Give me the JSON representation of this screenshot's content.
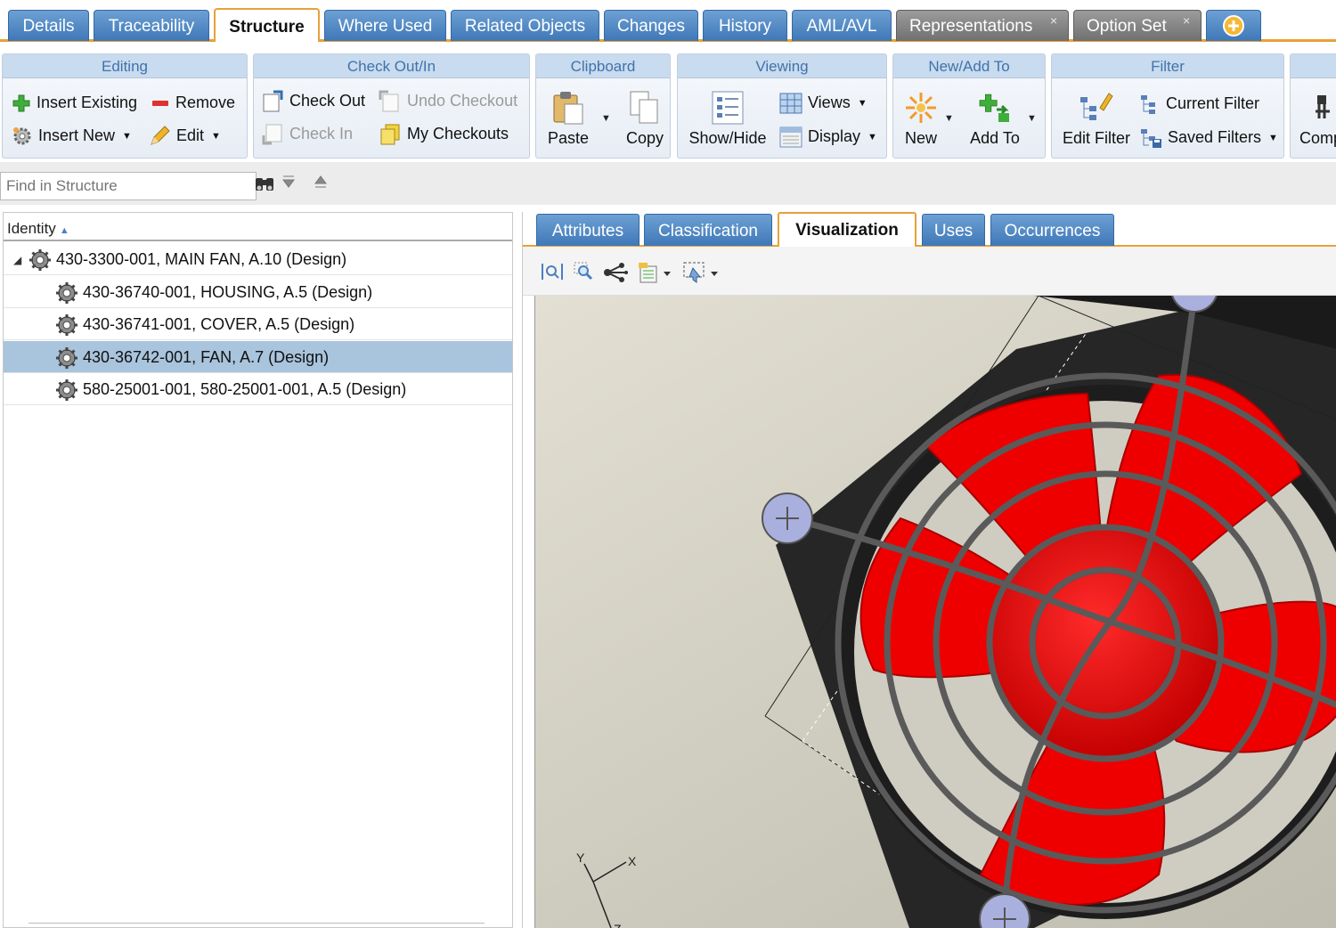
{
  "top_tabs": [
    {
      "label": "Details"
    },
    {
      "label": "Traceability"
    },
    {
      "label": "Structure"
    },
    {
      "label": "Where Used"
    },
    {
      "label": "Related Objects"
    },
    {
      "label": "Changes"
    },
    {
      "label": "History"
    },
    {
      "label": "AML/AVL"
    },
    {
      "label": "Representations",
      "close": "×"
    },
    {
      "label": "Option Set",
      "close": "×"
    }
  ],
  "active_top_tab": "Structure",
  "ribbon": {
    "editing": {
      "title": "Editing",
      "insert_existing": "Insert Existing",
      "remove": "Remove",
      "insert_new": "Insert New",
      "edit": "Edit"
    },
    "checkout": {
      "title": "Check Out/In",
      "check_out": "Check Out",
      "undo_checkout": "Undo Checkout",
      "check_in": "Check In",
      "my_checkouts": "My Checkouts"
    },
    "clipboard": {
      "title": "Clipboard",
      "paste": "Paste",
      "copy": "Copy"
    },
    "viewing": {
      "title": "Viewing",
      "show_hide": "Show/Hide",
      "views": "Views",
      "display": "Display"
    },
    "new_add": {
      "title": "New/Add To",
      "new": "New",
      "add_to": "Add To"
    },
    "filter": {
      "title": "Filter",
      "edit_filter": "Edit Filter",
      "current_filter": "Current Filter",
      "saved_filters": "Saved Filters"
    },
    "compare": {
      "label": "Comp"
    }
  },
  "find": {
    "placeholder": "Find in Structure"
  },
  "tree": {
    "column_header": "Identity",
    "rows": [
      {
        "label": "430-3300-001, MAIN FAN, A.10 (Design)",
        "level": 0,
        "expanded": true,
        "selected": false
      },
      {
        "label": "430-36740-001, HOUSING, A.5 (Design)",
        "level": 1,
        "selected": false
      },
      {
        "label": "430-36741-001, COVER, A.5 (Design)",
        "level": 1,
        "selected": false
      },
      {
        "label": "430-36742-001, FAN, A.7 (Design)",
        "level": 1,
        "selected": true
      },
      {
        "label": "580-25001-001, 580-25001-001, A.5 (Design)",
        "level": 1,
        "selected": false
      }
    ]
  },
  "detail_tabs": [
    {
      "label": "Attributes"
    },
    {
      "label": "Classification"
    },
    {
      "label": "Visualization"
    },
    {
      "label": "Uses"
    },
    {
      "label": "Occurrences"
    }
  ],
  "active_detail_tab": "Visualization",
  "viewer": {
    "axis_x": "X",
    "axis_y": "Y",
    "axis_z": "Z"
  },
  "colors": {
    "tab_blue": "#4f86c6",
    "accent_orange": "#e8a13a",
    "fan_red": "#ff0000",
    "selected_row": "#a9c4dd"
  }
}
